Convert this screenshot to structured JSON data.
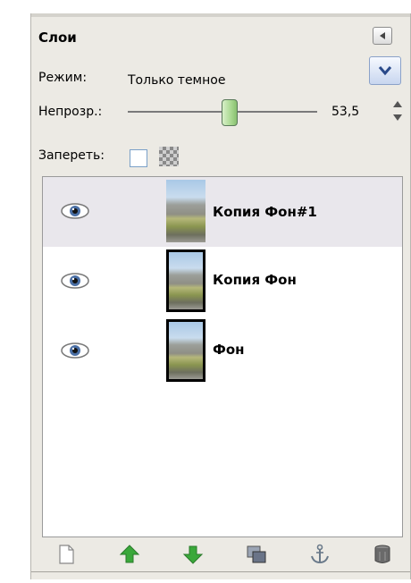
{
  "panel": {
    "title": "Слои"
  },
  "mode": {
    "label": "Режим:",
    "value": "Только темное"
  },
  "opacity": {
    "label": "Непрозр.:",
    "value": "53,5",
    "fraction": 0.535
  },
  "lock": {
    "label": "Запереть:"
  },
  "layers": [
    {
      "name": "Копия Фон#1",
      "visible": true,
      "selected": true
    },
    {
      "name": "Копия Фон",
      "visible": true,
      "selected": false
    },
    {
      "name": "Фон",
      "visible": true,
      "selected": false
    }
  ],
  "toolbar": {
    "icons": [
      "new-layer-icon",
      "raise-layer-icon",
      "lower-layer-icon",
      "duplicate-layer-icon",
      "anchor-layer-icon",
      "delete-layer-icon"
    ]
  },
  "colors": {
    "selected_row": "#e9e7ec",
    "arrow_green": "#3aa83a"
  }
}
